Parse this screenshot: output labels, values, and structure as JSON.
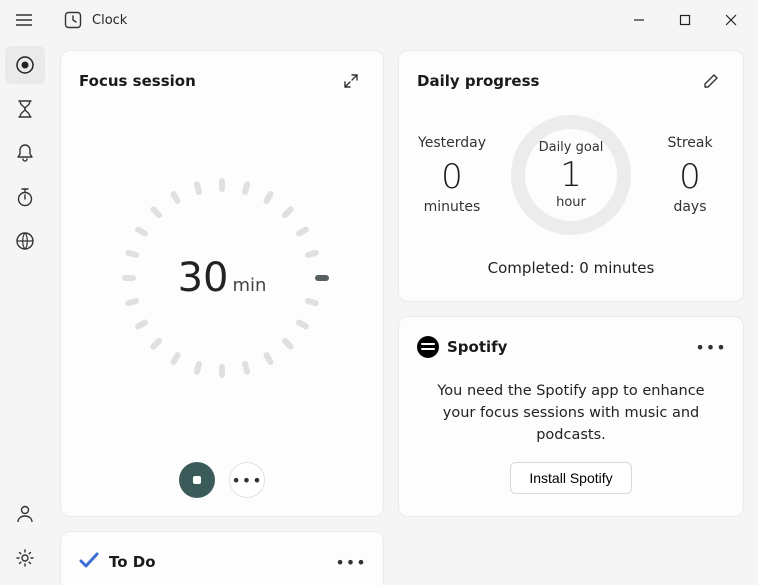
{
  "app": {
    "title": "Clock"
  },
  "sidebar": {
    "items": [
      {
        "name": "focus-sessions",
        "active": true
      },
      {
        "name": "timer"
      },
      {
        "name": "alarm"
      },
      {
        "name": "stopwatch"
      },
      {
        "name": "world-clock"
      }
    ]
  },
  "focus": {
    "title": "Focus session",
    "duration_value": "30",
    "duration_unit": "min"
  },
  "progress": {
    "title": "Daily progress",
    "yesterday": {
      "label": "Yesterday",
      "value": "0",
      "unit": "minutes"
    },
    "goal": {
      "label": "Daily goal",
      "value": "1",
      "unit": "hour"
    },
    "streak": {
      "label": "Streak",
      "value": "0",
      "unit": "days"
    },
    "completed_text": "Completed: 0 minutes"
  },
  "spotify": {
    "brand": "Spotify",
    "message": "You need the Spotify app to enhance your focus sessions with music and podcasts.",
    "install_label": "Install Spotify"
  },
  "todo": {
    "title": "To Do"
  }
}
